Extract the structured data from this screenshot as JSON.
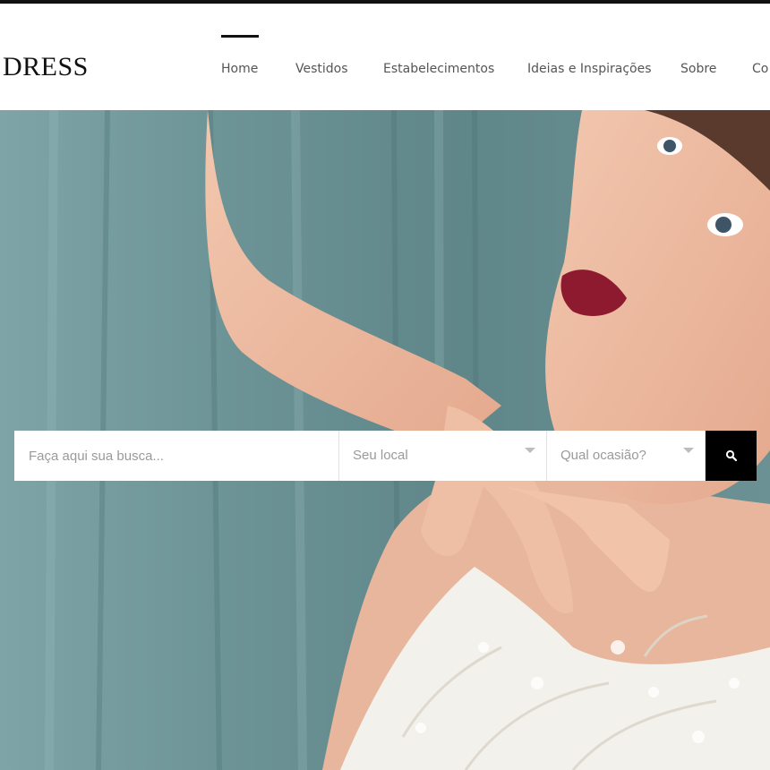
{
  "header": {
    "logo": "DRESS",
    "nav": [
      {
        "label": "Home",
        "active": true
      },
      {
        "label": "Vestidos",
        "active": false
      },
      {
        "label": "Estabelecimentos",
        "active": false
      },
      {
        "label": "Ideias e Inspirações",
        "active": false
      },
      {
        "label": "Sobre",
        "active": false
      },
      {
        "label": "Co",
        "active": false
      }
    ]
  },
  "search": {
    "query_placeholder": "Faça aqui sua busca...",
    "location_label": "Seu local",
    "occasion_label": "Qual ocasião?",
    "button_icon": "search-icon"
  },
  "colors": {
    "accent": "#000000",
    "curtain": "#6f9699",
    "lips": "#8e1a30"
  }
}
